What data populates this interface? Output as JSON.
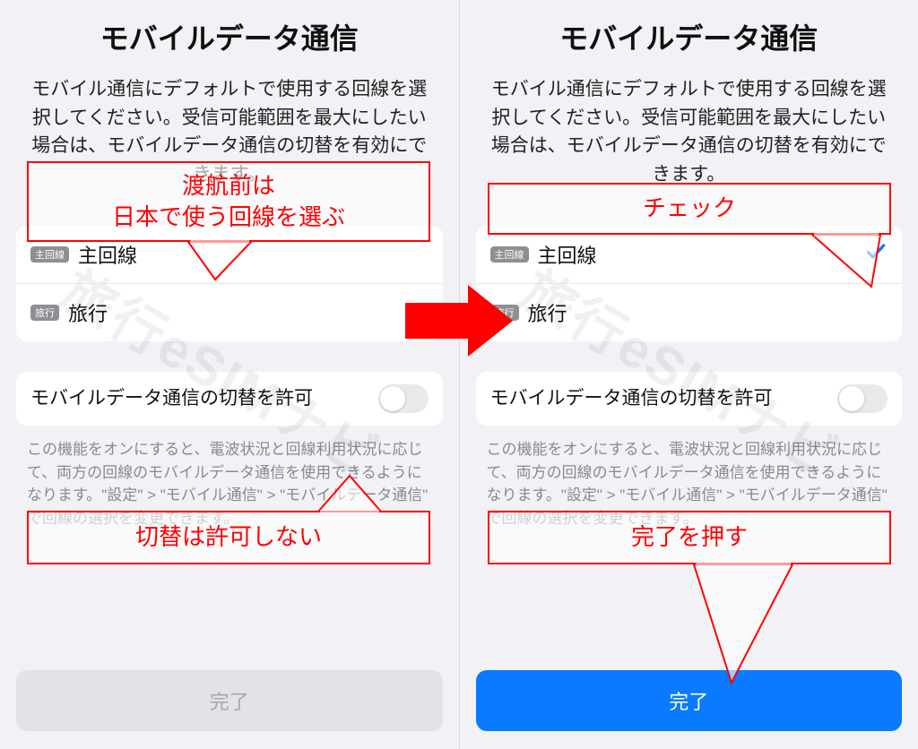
{
  "watermark": "旅行eSIMナビ",
  "left": {
    "title": "モバイルデータ通信",
    "desc": "モバイル通信にデフォルトで使用する回線を選択してください。受信可能範囲を最大にしたい場合は、モバイルデータ通信の切替を有効にできます。",
    "line_primary_badge": "主回線",
    "line_primary_label": "主回線",
    "line_travel_badge": "旅行",
    "line_travel_label": "旅行",
    "toggle_label": "モバイルデータ通信の切替を許可",
    "hint": "この機能をオンにすると、電波状況と回線利用状況に応じて、両方の回線のモバイルデータ通信を使用できるようになります。\"設定\" > \"モバイル通信\" > \"モバイルデータ通信\" で回線の選択を変更できます。",
    "done": "完了"
  },
  "right": {
    "title": "モバイルデータ通信",
    "desc": "モバイル通信にデフォルトで使用する回線を選択してください。受信可能範囲を最大にしたい場合は、モバイルデータ通信の切替を有効にできます。",
    "line_primary_badge": "主回線",
    "line_primary_label": "主回線",
    "line_travel_badge": "旅行",
    "line_travel_label": "旅行",
    "toggle_label": "モバイルデータ通信の切替を許可",
    "hint": "この機能をオンにすると、電波状況と回線利用状況に応じて、両方の回線のモバイルデータ通信を使用できるようになります。\"設定\" > \"モバイル通信\" > \"モバイルデータ通信\" で回線の選択を変更できます。",
    "done": "完了"
  },
  "annotations": {
    "left_top_l1": "渡航前は",
    "left_top_l2": "日本で使う回線を選ぶ",
    "left_bottom": "切替は許可しない",
    "right_top": "チェック",
    "right_bottom": "完了を押す"
  }
}
